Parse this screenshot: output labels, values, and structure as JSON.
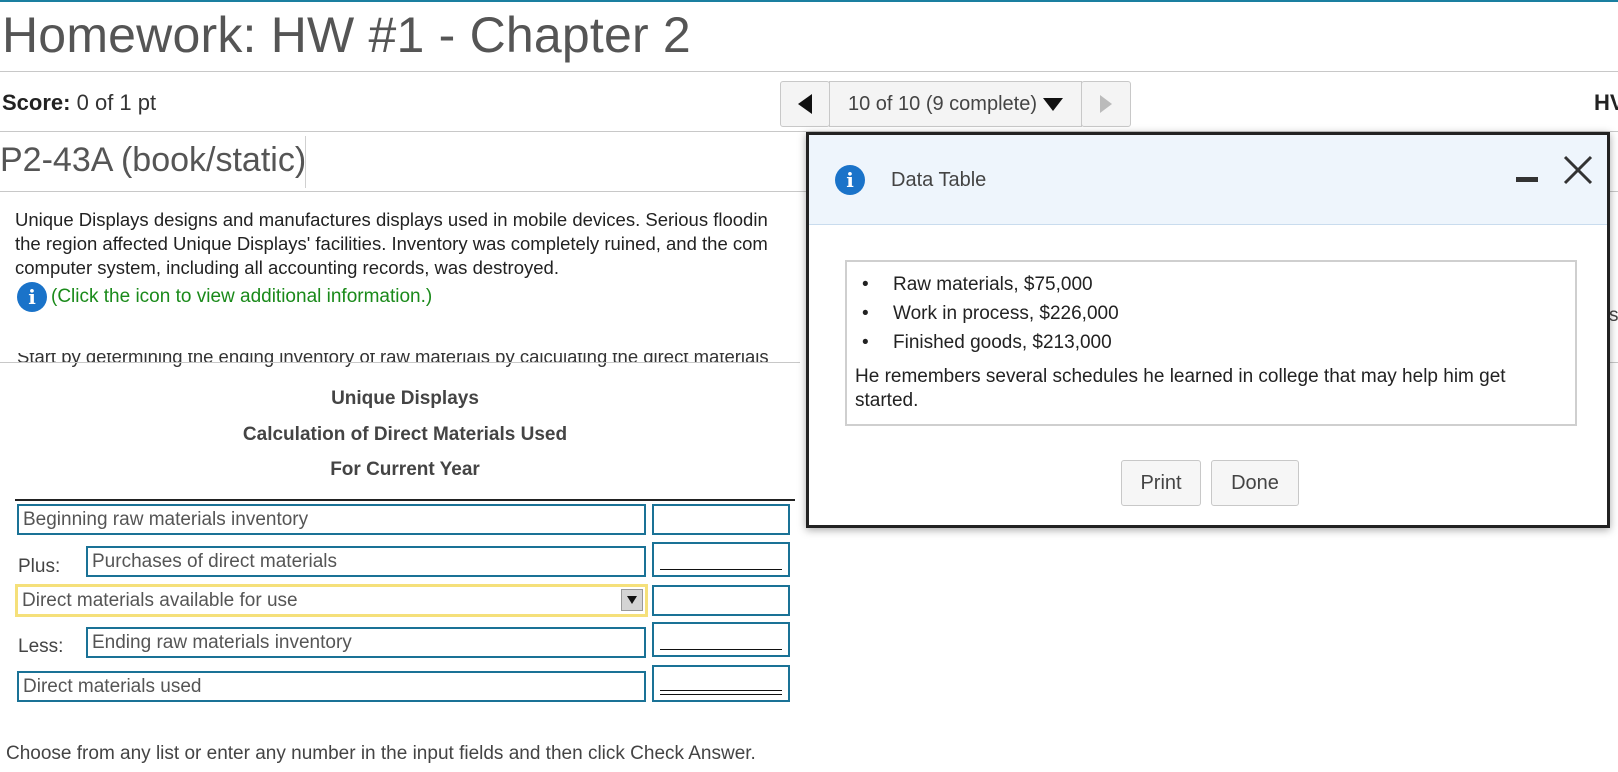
{
  "header": {
    "title": "Homework: HW #1 - Chapter 2",
    "score_label": "Score:",
    "score_value": "0 of 1 pt",
    "right_clip": "HV"
  },
  "navigation": {
    "prev_icon": "triangle-left-icon",
    "position_label": "10 of 10 (9 complete)",
    "dropdown_icon": "caret-down-icon",
    "next_icon": "triangle-right-icon"
  },
  "question": {
    "id": "P2-43A (book/static)",
    "problem_lines": [
      "Unique Displays designs and manufactures displays used in mobile devices. Serious floodin",
      "the region affected Unique Displays' facilities. Inventory was completely ruined, and the com",
      "computer system, including all accounting records, was destroyed."
    ],
    "info_link": "(Click the icon to view additional information.)",
    "instruction_partial": "Start by determining the ending inventory of raw materials by calculating the direct materials",
    "right_clip_char": "s"
  },
  "schedule": {
    "company": "Unique Displays",
    "title": "Calculation of Direct Materials Used",
    "period": "For Current Year",
    "rows": [
      {
        "prefix": "",
        "label": "Beginning raw materials inventory",
        "amount": "",
        "has_dropdown": false,
        "underline": "none"
      },
      {
        "prefix": "Plus:",
        "label": "Purchases of direct materials",
        "amount": "",
        "has_dropdown": false,
        "underline": "single"
      },
      {
        "prefix": "",
        "label": "Direct materials available for use",
        "amount": "",
        "has_dropdown": true,
        "underline": "none"
      },
      {
        "prefix": "Less:",
        "label": "Ending raw materials inventory",
        "amount": "",
        "has_dropdown": false,
        "underline": "single"
      },
      {
        "prefix": "",
        "label": "Direct materials used",
        "amount": "",
        "has_dropdown": false,
        "underline": "double"
      }
    ]
  },
  "footer": {
    "instruction": "Choose from any list or enter any number in the input fields and then click Check Answer."
  },
  "modal": {
    "title": "Data Table",
    "minimize_icon": "minimize-icon",
    "close_icon": "close-icon",
    "items": [
      "Raw materials, $75,000",
      "Work in process, $226,000",
      "Finished goods, $213,000"
    ],
    "note": "He remembers several schedules he learned in college that may help him get started.",
    "print_label": "Print",
    "done_label": "Done"
  },
  "colors": {
    "accent_border": "#1a7296",
    "info_icon": "#1a73c9",
    "link_green": "#1a8a1a",
    "selected_highlight": "#f5e07a",
    "modal_header_bg": "#eef5fc"
  }
}
